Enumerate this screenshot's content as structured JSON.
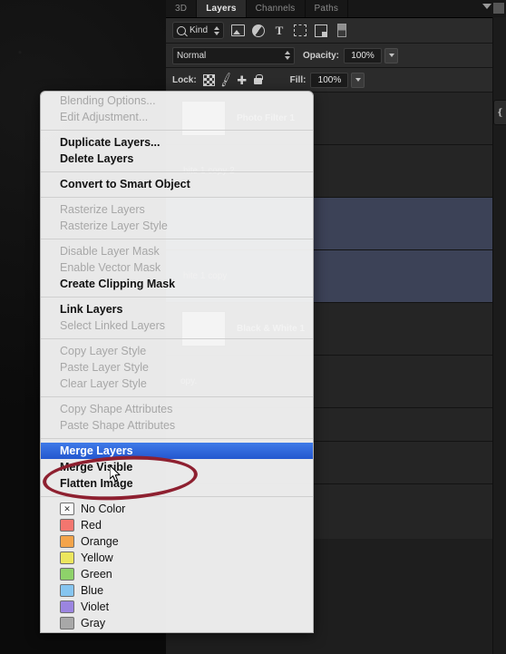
{
  "panel": {
    "tabs": [
      {
        "label": "3D",
        "active": false
      },
      {
        "label": "Layers",
        "active": true
      },
      {
        "label": "Channels",
        "active": false
      },
      {
        "label": "Paths",
        "active": false
      }
    ],
    "filter": {
      "kind_label": "Kind",
      "search_icon": "search-icon",
      "icons": [
        "pixel-filter-icon",
        "adjustment-filter-icon",
        "type-filter-icon",
        "shape-filter-icon",
        "smart-object-filter-icon",
        "filter-toggle-icon"
      ]
    },
    "blend": {
      "mode": "Normal",
      "opacity_label": "Opacity:",
      "opacity_value": "100%"
    },
    "lock": {
      "label": "Lock:",
      "icons": [
        "lock-transparent-pixels-icon",
        "lock-image-pixels-icon",
        "lock-position-icon",
        "lock-all-icon"
      ],
      "fill_label": "Fill:",
      "fill_value": "100%"
    },
    "side_handle_icon": "double-arrow-icon"
  },
  "layers": [
    {
      "name": "Photo Filter 1",
      "selected": false,
      "thumb": true
    },
    {
      "name": "hite 1 copy 2",
      "selected": false,
      "thumb": false
    },
    {
      "name": "",
      "selected": true,
      "thumb": false
    },
    {
      "name": "hite 1 copy",
      "selected": true,
      "thumb": false
    },
    {
      "name": "Black & White 1",
      "selected": false,
      "thumb": true
    },
    {
      "name": "opy.",
      "selected": false,
      "thumb": false
    },
    {
      "name": "",
      "selected": false,
      "thumb": false
    },
    {
      "name": "",
      "selected": false,
      "thumb": false
    },
    {
      "name": "",
      "selected": false,
      "thumb": false
    }
  ],
  "context_menu": {
    "groups": [
      {
        "items": [
          {
            "label": "Blending Options...",
            "state": "disabled"
          },
          {
            "label": "Edit Adjustment...",
            "state": "disabled"
          }
        ]
      },
      {
        "items": [
          {
            "label": "Duplicate Layers...",
            "state": "enabled"
          },
          {
            "label": "Delete Layers",
            "state": "enabled"
          }
        ]
      },
      {
        "items": [
          {
            "label": "Convert to Smart Object",
            "state": "enabled"
          }
        ]
      },
      {
        "items": [
          {
            "label": "Rasterize Layers",
            "state": "disabled"
          },
          {
            "label": "Rasterize Layer Style",
            "state": "disabled"
          }
        ]
      },
      {
        "items": [
          {
            "label": "Disable Layer Mask",
            "state": "disabled"
          },
          {
            "label": "Enable Vector Mask",
            "state": "disabled"
          },
          {
            "label": "Create Clipping Mask",
            "state": "enabled"
          }
        ]
      },
      {
        "items": [
          {
            "label": "Link Layers",
            "state": "enabled"
          },
          {
            "label": "Select Linked Layers",
            "state": "disabled"
          }
        ]
      },
      {
        "items": [
          {
            "label": "Copy Layer Style",
            "state": "disabled"
          },
          {
            "label": "Paste Layer Style",
            "state": "disabled"
          },
          {
            "label": "Clear Layer Style",
            "state": "disabled"
          }
        ]
      },
      {
        "items": [
          {
            "label": "Copy Shape Attributes",
            "state": "disabled"
          },
          {
            "label": "Paste Shape Attributes",
            "state": "disabled"
          }
        ]
      },
      {
        "items": [
          {
            "label": "Merge Layers",
            "state": "highlighted"
          },
          {
            "label": "Merge Visible",
            "state": "enabled"
          },
          {
            "label": "Flatten Image",
            "state": "enabled"
          }
        ]
      }
    ],
    "colors": [
      {
        "label": "No Color",
        "swatch": "none",
        "hex": "#fbfbfb"
      },
      {
        "label": "Red",
        "swatch": "fill",
        "hex": "#f3766f"
      },
      {
        "label": "Orange",
        "swatch": "fill",
        "hex": "#f4a44a"
      },
      {
        "label": "Yellow",
        "swatch": "fill",
        "hex": "#ece65e"
      },
      {
        "label": "Green",
        "swatch": "fill",
        "hex": "#8ed26a"
      },
      {
        "label": "Blue",
        "swatch": "fill",
        "hex": "#86c5f0"
      },
      {
        "label": "Violet",
        "swatch": "fill",
        "hex": "#9b85e0"
      },
      {
        "label": "Gray",
        "swatch": "fill",
        "hex": "#a8a8a8"
      }
    ],
    "highlight_color": "#2457cf",
    "no_color_glyph": "✕"
  },
  "annotation": {
    "ellipse_color": "#8e2030",
    "target_item": "Merge Layers",
    "cursor_icon": "mouse-pointer-icon"
  }
}
